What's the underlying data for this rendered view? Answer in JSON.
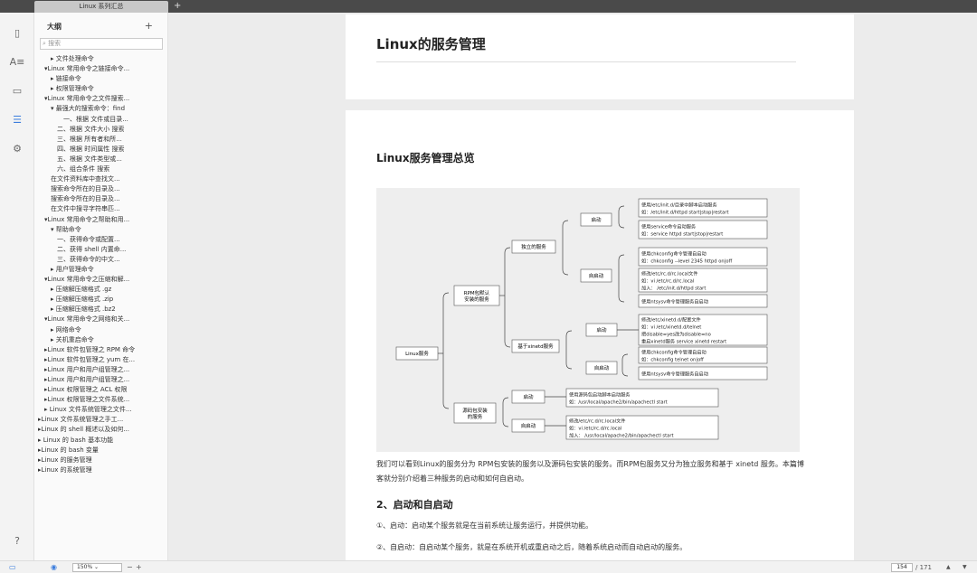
{
  "tab": {
    "title": "Linux 系列汇总",
    "add": "+"
  },
  "sidebar": {
    "heading": "大纲",
    "add": "+",
    "search_placeholder": "搜索",
    "items": [
      {
        "label": "▸ 文件处理命令",
        "indent": 2
      },
      {
        "label": "▾Linux 常用命令之链接命令...",
        "indent": 1
      },
      {
        "label": "▸ 链接命令",
        "indent": 2
      },
      {
        "label": "▸ 权限管理命令",
        "indent": 2
      },
      {
        "label": "▾Linux 常用命令之文件搜索...",
        "indent": 1
      },
      {
        "label": "▾ 最强大的搜索命令：find",
        "indent": 2
      },
      {
        "label": "一、根据 文件或目录...",
        "indent": 4
      },
      {
        "label": "二、根据 文件大小 搜索",
        "indent": 3
      },
      {
        "label": "三、根据 所有者和所...",
        "indent": 3
      },
      {
        "label": "四、根据 时间属性 搜索",
        "indent": 3
      },
      {
        "label": "五、根据 文件类型或...",
        "indent": 3
      },
      {
        "label": "六、组合条件 搜索",
        "indent": 3
      },
      {
        "label": "在文件资料库中查找文...",
        "indent": 2
      },
      {
        "label": "搜索命令所在的目录及...",
        "indent": 2
      },
      {
        "label": "搜索命令所在的目录及...",
        "indent": 2
      },
      {
        "label": "在文件中搜寻字符串匹...",
        "indent": 2
      },
      {
        "label": "▾Linux 常用命令之帮助和用...",
        "indent": 1
      },
      {
        "label": "▾ 帮助命令",
        "indent": 2
      },
      {
        "label": "一、获得命令或配置...",
        "indent": 3
      },
      {
        "label": "二、获得 shell 内置命...",
        "indent": 3
      },
      {
        "label": "三、获得命令的中文...",
        "indent": 3
      },
      {
        "label": "▸ 用户管理命令",
        "indent": 2
      },
      {
        "label": "▾Linux 常用命令之压缩和解...",
        "indent": 1
      },
      {
        "label": "▸ 压缩解压缩格式 .gz",
        "indent": 2
      },
      {
        "label": "▸ 压缩解压缩格式 .zip",
        "indent": 2
      },
      {
        "label": "▸ 压缩解压缩格式 .bz2",
        "indent": 2
      },
      {
        "label": "▾Linux 常用命令之网络和关...",
        "indent": 1
      },
      {
        "label": "▸ 网络命令",
        "indent": 2
      },
      {
        "label": "▸ 关机重启命令",
        "indent": 2
      },
      {
        "label": "▸Linux 软件包管理之 RPM 命令",
        "indent": 1
      },
      {
        "label": "▸Linux 软件包管理之 yum 在...",
        "indent": 1
      },
      {
        "label": "▸Linux 用户和用户组管理之...",
        "indent": 1
      },
      {
        "label": "▸Linux 用户和用户组管理之...",
        "indent": 1
      },
      {
        "label": "▸Linux 权限管理之 ACL 权限",
        "indent": 1
      },
      {
        "label": "▸Linux 权限管理之文件系统...",
        "indent": 1
      },
      {
        "label": "▸ Linux 文件系统管理之文件...",
        "indent": 1
      },
      {
        "label": "▸Linux 文件系统管理之手工...",
        "indent": 0
      },
      {
        "label": "▸Linux 的 shell 概述以及如何...",
        "indent": 0
      },
      {
        "label": "▸ Linux 的 bash 基本功能",
        "indent": 0
      },
      {
        "label": "▸Linux 的 bash 变量",
        "indent": 0
      },
      {
        "label": "▸Linux 的服务管理",
        "indent": 0
      },
      {
        "label": "▸Linux 的系统管理",
        "indent": 0
      }
    ]
  },
  "rail": {
    "icons": [
      "files-icon",
      "text-icon",
      "book-icon",
      "outline-icon",
      "settings-icon",
      "help-icon"
    ]
  },
  "doc": {
    "page_title": "Linux的服务管理",
    "section_title": "Linux服务管理总览",
    "para1": "我们可以看到Linux的服务分为 RPM包安装的服务以及源码包安装的服务。而RPM包服务又分为独立服务和基于 xinetd 服务。本篇博客就分别介绍着三种服务的启动和如何自启动。",
    "sub_title": "2、启动和自启动",
    "para2": "①、启动：启动某个服务就是在当前系统让服务运行，并提供功能。",
    "para3": "②、自启动：自启动某个服务，就是在系统开机或重启动之后，随着系统启动而自动启动的服务。"
  },
  "diagram": {
    "root": "Linux服务",
    "rpm": [
      "RPM包默认",
      "安装的服务"
    ],
    "src": [
      "源码包安装",
      "的服务"
    ],
    "standalone": "独立的服务",
    "xinetd": "基于xinetd服务",
    "start": "启动",
    "autostart": "自启动",
    "sa_start_1": [
      "使用/etc/init.d/目录中脚本启动服务",
      "如：/etc/init.d/httpd start|stop|restart"
    ],
    "sa_start_2": [
      "使用service命令启动服务",
      "如：service  httpd  start|stop|restart"
    ],
    "sa_auto_1": [
      "使用chkconfig命令管理自启动",
      "如：chkconfig --level 2345 httpd on|off"
    ],
    "sa_auto_2": [
      "修改/etc/rc.d/rc.local文件",
      "如：vi /etc/rc.d/rc.local",
      "加入：          /etc/init.d/httpd start"
    ],
    "sa_auto_3": [
      "使用ntsysv命令管理服务自启动"
    ],
    "x_start_1": [
      "修改/etc/xinetd.d/配置文件",
      "如：vi /etc/xinetd.d/telnet",
      "把disable=yes改为disable=no",
      "重启xinetd服务  service  xinetd restart"
    ],
    "x_auto_1": [
      "使用chkconfig命令管理自启动",
      "如：chkconfig telnet  on|off"
    ],
    "x_auto_2": [
      "使用ntsysv命令管理服务自启动"
    ],
    "src_start_1": [
      "使用源码包启动脚本启动服务",
      "如：/usr/local/apache2/bin/apachectl start"
    ],
    "src_auto_1": [
      "修改/etc/rc.d/rc.local文件",
      "如：vi /etc/rc.d/rc.local",
      "加入：  /usr/local/apache2/bin/apachectl start"
    ]
  },
  "status": {
    "zoom": "150% ⌄",
    "minus": "−",
    "plus": "+",
    "page_current": "154",
    "page_total": "/ 171",
    "up": "▲",
    "down": "▼"
  },
  "colors": {
    "accent": "#3b7ddd",
    "tabbar": "#4a4a4a"
  }
}
